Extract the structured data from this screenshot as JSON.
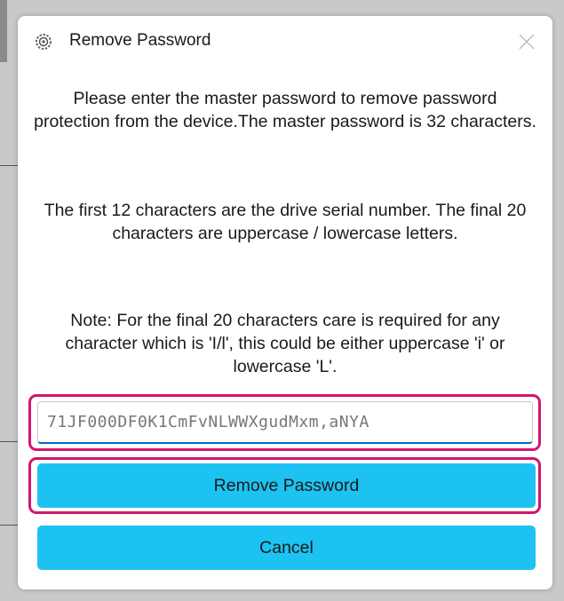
{
  "dialog": {
    "title": "Remove Password",
    "icons": {
      "app": "gear-icon",
      "close": "close-icon"
    },
    "message": {
      "paragraph1": "Please enter the master password to remove password protection from the device.The master password is 32 characters.",
      "paragraph2": "The first 12 characters are the drive serial number. The final 20 characters are uppercase / lowercase letters.",
      "paragraph3": "Note: For the final 20 characters care is required for any character which is 'I/l', this could be either uppercase 'i' or lowercase 'L'."
    },
    "password_input": {
      "value": "71JF000DF0K1CmFvNLWWXgudMxm,aNYA"
    },
    "buttons": {
      "remove_label": "Remove Password",
      "cancel_label": "Cancel"
    }
  },
  "colors": {
    "button_bg": "#1cc3f2",
    "highlight": "#d1166e",
    "input_focus": "#0067c0"
  }
}
